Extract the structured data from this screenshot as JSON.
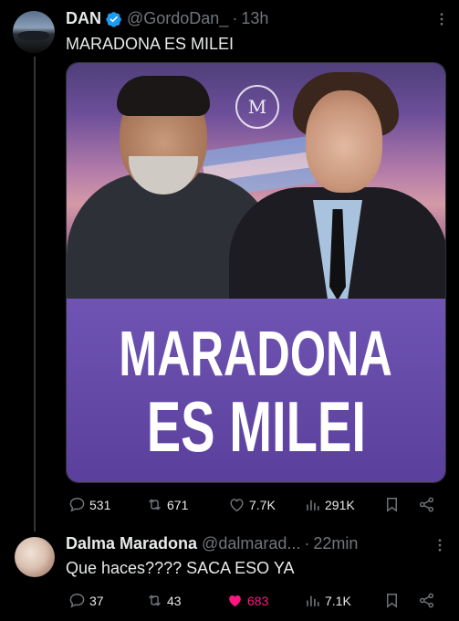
{
  "tweet": {
    "author_name": "DAN",
    "author_handle": "@GordoDan_",
    "separator": "·",
    "time": "13h",
    "text": "MARADONA ES MILEI",
    "media": {
      "banner_line1": "MARADONA",
      "banner_line2": "ES MILEI"
    },
    "actions": {
      "replies": "531",
      "retweets": "671",
      "likes": "7.7K",
      "views": "291K"
    }
  },
  "reply": {
    "author_name": "Dalma Maradona",
    "author_handle": "@dalmarad...",
    "separator": "·",
    "time": "22min",
    "text": "Que haces???? SACA ESO YA",
    "actions": {
      "replies": "37",
      "retweets": "43",
      "likes": "683",
      "views": "7.1K"
    },
    "liked": true
  },
  "colors": {
    "background": "#000000",
    "text": "#e7e9ea",
    "secondary": "#71767b",
    "verified": "#1d9bf0",
    "like_active": "#f91880",
    "banner": "#6f54b3"
  },
  "icons": [
    "more-icon",
    "verified-badge-icon",
    "reply-icon",
    "retweet-icon",
    "like-icon",
    "views-icon",
    "bookmark-icon",
    "share-icon"
  ]
}
